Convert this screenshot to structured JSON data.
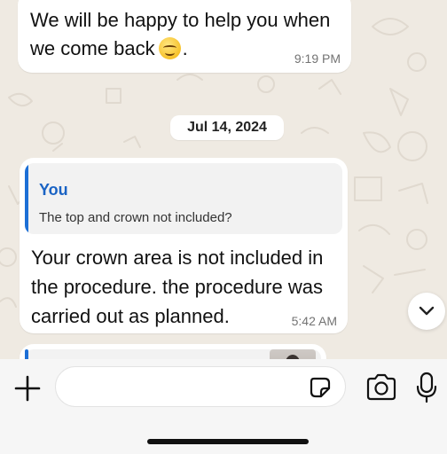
{
  "chat": {
    "messages": [
      {
        "lines": [
          "We will be happy to help you when",
          "we come back"
        ],
        "trailing": ".",
        "emoji": "smiling-face-icon",
        "time": "9:19 PM"
      },
      {
        "quote_author": "You",
        "quote_text": "The top and crown not included?",
        "text": "Your crown area is not included in the procedure. the procedure was carried out as planned.",
        "time": "5:42 AM"
      }
    ],
    "date_divider": "Jul 14, 2024"
  },
  "composer": {
    "value": "",
    "placeholder": ""
  },
  "colors": {
    "wallpaper": "#efeae2",
    "bubble": "#ffffff",
    "quote_accent": "#1c6fd6"
  },
  "icons": {
    "plus": "plus-icon",
    "sticker": "sticker-icon",
    "camera": "camera-icon",
    "mic": "microphone-icon",
    "scroll": "chevron-down-icon"
  }
}
